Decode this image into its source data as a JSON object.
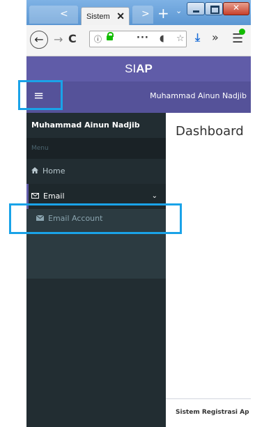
{
  "browser": {
    "tab_title": "Sistem",
    "tab_close": "✕",
    "new_tab": "+",
    "tab_dropdown": "⌄",
    "nav_left": "<",
    "nav_right": ">",
    "back": "←",
    "forward": "→",
    "reload": "C",
    "url_info": "ⓘ",
    "url_actions": "···",
    "pocket": "◖",
    "star": "☆",
    "download": "⤓",
    "overflow": "»",
    "menu": "☰",
    "close_window": "✕"
  },
  "app": {
    "brand_prefix": "SI",
    "brand_suffix": "AP",
    "hamburger": "≡",
    "user_name_nav": "Muhammad Ainun Nadjib",
    "sidebar": {
      "user_name": "Muhammad Ainun Nadjib",
      "section_header": "Menu",
      "items": [
        {
          "icon": "home-icon",
          "label": "Home"
        },
        {
          "icon": "envelope-outline-icon",
          "label": "Email",
          "expanded": true
        }
      ],
      "subitems": [
        {
          "icon": "envelope-icon",
          "label": "Email Account"
        }
      ],
      "chevron": "⌄"
    },
    "page_title": "Dashboard",
    "footer_text": "Sistem Registrasi Ap"
  },
  "colors": {
    "header": "#605ca8",
    "navbar": "#555299",
    "sidebar": "#222d32",
    "highlight": "#1aa3e8"
  }
}
